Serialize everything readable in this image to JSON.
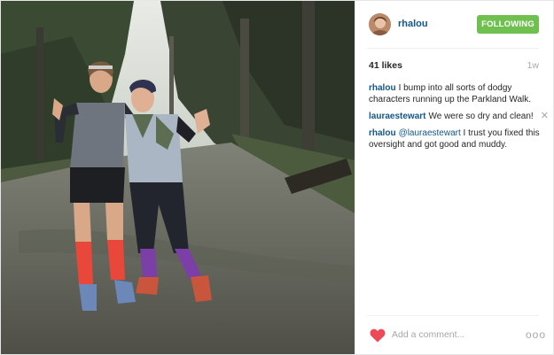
{
  "post": {
    "username": "rhalou",
    "follow_label": "FOLLOWING",
    "likes": "41 likes",
    "time": "1w",
    "add_comment_placeholder": "Add a comment...",
    "more_label": "ooo",
    "comments": [
      {
        "author": "rhalou",
        "text": "I bump into all sorts of dodgy characters running up the Parkland Walk."
      },
      {
        "author": "lauraestewart",
        "text": "We were so dry and clean!",
        "delete": "✕"
      },
      {
        "author": "rhalou",
        "mention": "@lauraestewart",
        "text": "I trust you fixed this oversight and got good and muddy."
      }
    ]
  },
  "colors": {
    "link": "#125688",
    "follow_button": "#70c050",
    "heart": "#ed4956",
    "muted": "#a5a7aa"
  },
  "icons": {
    "avatar": "avatar",
    "heart": "heart-icon",
    "delete": "close-icon",
    "more": "more-options-icon"
  }
}
